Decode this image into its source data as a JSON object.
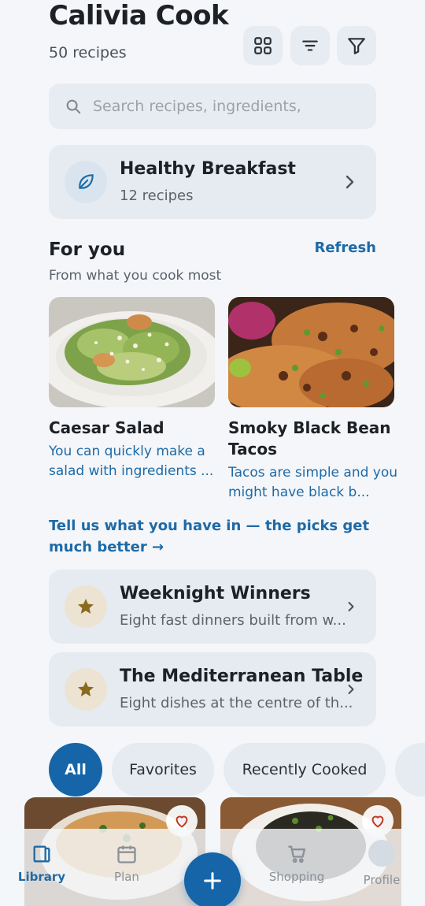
{
  "header": {
    "title": "Calivia Cook",
    "recipe_count": "50 recipes",
    "tools": [
      "grid-view-icon",
      "sort-icon",
      "filter-icon"
    ]
  },
  "search": {
    "placeholder": "Search recipes, ingredients,",
    "value": ""
  },
  "featured_collection": {
    "title": "Healthy Breakfast",
    "subtitle": "12 recipes",
    "icon": "leaf-icon"
  },
  "for_you": {
    "title": "For you",
    "subtitle": "From what you cook most",
    "refresh_label": "Refresh",
    "picks": [
      {
        "title": "Caesar Salad",
        "description": "You can quickly make a salad with ingredients ..."
      },
      {
        "title": "Smoky Black Bean Tacos",
        "description": "Tacos are simple and you might have black b..."
      }
    ],
    "hint": "Tell us what you have in — the picks get much better →"
  },
  "collections": [
    {
      "title": "Weeknight Winners",
      "subtitle": "Eight fast dinners built from w...",
      "icon": "star-icon"
    },
    {
      "title": "The Mediterranean Table",
      "subtitle": "Eight dishes at the centre of th...",
      "icon": "star-icon"
    }
  ],
  "filters": {
    "chips": [
      "All",
      "Favorites",
      "Recently Cooked"
    ],
    "selected": "All"
  },
  "bottom_nav": {
    "items": [
      "Library",
      "Plan",
      "Shopping",
      "Profile"
    ],
    "active": "Library",
    "fab_icon": "plus-icon"
  },
  "colors": {
    "accent": "#1565a8",
    "link": "#1e6aa6",
    "background": "#f4f6f9",
    "card": "#e6ebf1",
    "star": "#8a6a1c"
  }
}
